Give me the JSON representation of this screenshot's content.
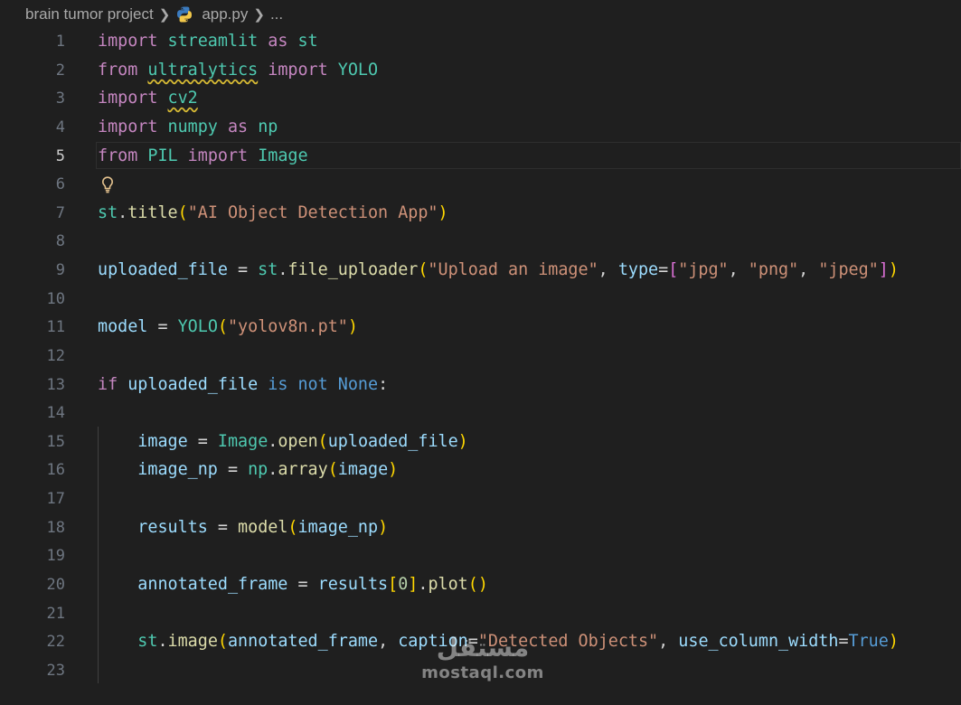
{
  "breadcrumb": {
    "folder": "brain tumor project",
    "file": "app.py",
    "more": "..."
  },
  "editor": {
    "active_line": 5,
    "line_numbers": [
      "1",
      "2",
      "3",
      "4",
      "5",
      "6",
      "7",
      "8",
      "9",
      "10",
      "11",
      "12",
      "13",
      "14",
      "15",
      "16",
      "17",
      "18",
      "19",
      "20",
      "21",
      "22",
      "23"
    ],
    "tokens": {
      "kw_import": "import",
      "kw_from": "from",
      "kw_as": "as",
      "kw_if": "if",
      "kw_is": "is",
      "kw_not": "not",
      "kw_none": "None",
      "kw_true": "True",
      "mod_streamlit": "streamlit",
      "mod_st": "st",
      "mod_ultralytics": "ultralytics",
      "cls_yolo": "YOLO",
      "mod_cv2": "cv2",
      "mod_numpy": "numpy",
      "mod_np": "np",
      "mod_pil": "PIL",
      "cls_image": "Image",
      "fn_title": "title",
      "str_title": "\"AI Object Detection App\"",
      "var_uploaded_file": "uploaded_file",
      "fn_file_uploader": "file_uploader",
      "str_upload": "\"Upload an image\"",
      "param_type": "type",
      "str_jpg": "\"jpg\"",
      "str_png": "\"png\"",
      "str_jpeg": "\"jpeg\"",
      "var_model": "model",
      "str_weights": "\"yolov8n.pt\"",
      "var_image": "image",
      "fn_open": "open",
      "var_image_np": "image_np",
      "fn_array": "array",
      "var_results": "results",
      "num_zero": "0",
      "fn_plot": "plot",
      "var_annotated_frame": "annotated_frame",
      "fn_image": "image",
      "param_caption": "caption",
      "str_caption": "\"Detected Objects\"",
      "param_use_column_width": "use_column_width"
    }
  },
  "watermark": {
    "arabic": "مستقل",
    "latin": "mostaql.com"
  },
  "colors": {
    "background": "#1f1f1f",
    "keyword": "#c586c0",
    "module": "#4ec9b0",
    "variable": "#9cdcfe",
    "function": "#dcdcaa",
    "string": "#ce9178",
    "constant": "#569cd6"
  },
  "icons": {
    "file_type": "python-icon",
    "breadcrumb_separator": "chevron-right-icon",
    "lightbulb": "lightbulb-icon"
  }
}
